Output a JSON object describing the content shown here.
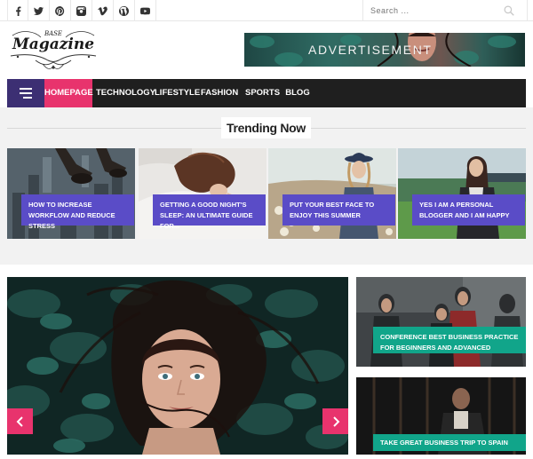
{
  "social": {
    "icons": [
      "facebook-icon",
      "twitter-icon",
      "pinterest-icon",
      "instagram-icon",
      "vimeo-icon",
      "wordpress-icon",
      "youtube-icon"
    ]
  },
  "search": {
    "placeholder": "Search ..."
  },
  "logo": {
    "small": "BASE",
    "main": "Magazine"
  },
  "ad": {
    "label": "ADVERTISEMENT"
  },
  "nav": {
    "items": [
      {
        "label": "HOMEPAGE"
      },
      {
        "label": "TECHNOLOGY"
      },
      {
        "label": "LIFESTYLE"
      },
      {
        "label": "FASHION"
      },
      {
        "label": "SPORTS"
      },
      {
        "label": "BLOG"
      }
    ]
  },
  "trending": {
    "title": "Trending Now",
    "cards": [
      {
        "caption": "HOW TO INCREASE WORKFLOW AND REDUCE STRESS"
      },
      {
        "caption": "GETTING A GOOD NIGHT'S SLEEP: AN ULTIMATE GUIDE FOR..."
      },
      {
        "caption": "PUT YOUR BEST FACE TO ENJOY THIS SUMMER"
      },
      {
        "caption": "YES I AM A PERSONAL BLOGGER AND I AM HAPPY"
      }
    ]
  },
  "side_posts": [
    {
      "caption": "CONFERENCE BEST BUSINESS PRACTICE FOR BEGINNERS AND ADVANCED"
    },
    {
      "caption": "TAKE GREAT BUSINESS TRIP TO SPAIN"
    }
  ],
  "colors": {
    "accent_pink": "#e8336d",
    "accent_purple": "#5a4cc7",
    "nav_dark": "#1f1f1f",
    "burger_purple": "#3c2f73",
    "teal": "#11a58a"
  }
}
